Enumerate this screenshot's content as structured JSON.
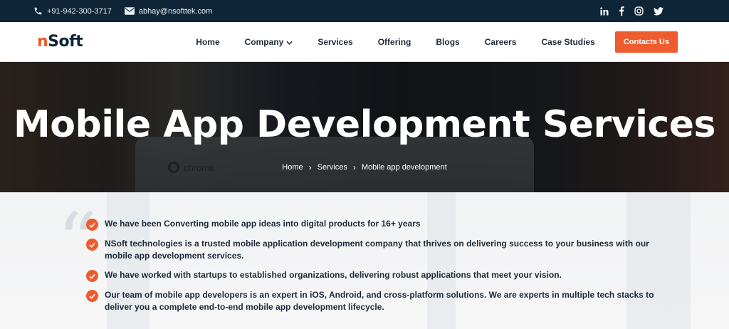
{
  "topbar": {
    "phone": "+91-942-300-3717",
    "email": "abhay@nsofttek.com",
    "social": [
      "linkedin-icon",
      "facebook-icon",
      "instagram-icon",
      "twitter-icon"
    ]
  },
  "brand": {
    "logo_first": "n",
    "logo_rest": "Soft"
  },
  "nav": {
    "items": [
      "Home",
      "Company",
      "Services",
      "Offering",
      "Blogs",
      "Careers",
      "Case Studies"
    ],
    "cta": "Contacts Us"
  },
  "hero": {
    "title": "Mobile App Development Services",
    "background_text": "chrome",
    "breadcrumb": [
      "Home",
      "Services",
      "Mobile app development"
    ]
  },
  "points": [
    "We have been Converting mobile app ideas into digital products for 16+ years",
    "NSoft technologies is a trusted mobile application development company that thrives on delivering success to your business with our mobile app development services.",
    "We have worked with startups to established organizations, delivering robust applications that meet your vision.",
    "Our team of mobile app developers is an expert in iOS, Android, and cross-platform solutions. We are experts in multiple tech stacks to deliver you a complete end-to-end mobile app development lifecycle."
  ],
  "colors": {
    "accent": "#ee5b2d",
    "topbar": "#0d2536",
    "text": "#1d2a3a"
  }
}
